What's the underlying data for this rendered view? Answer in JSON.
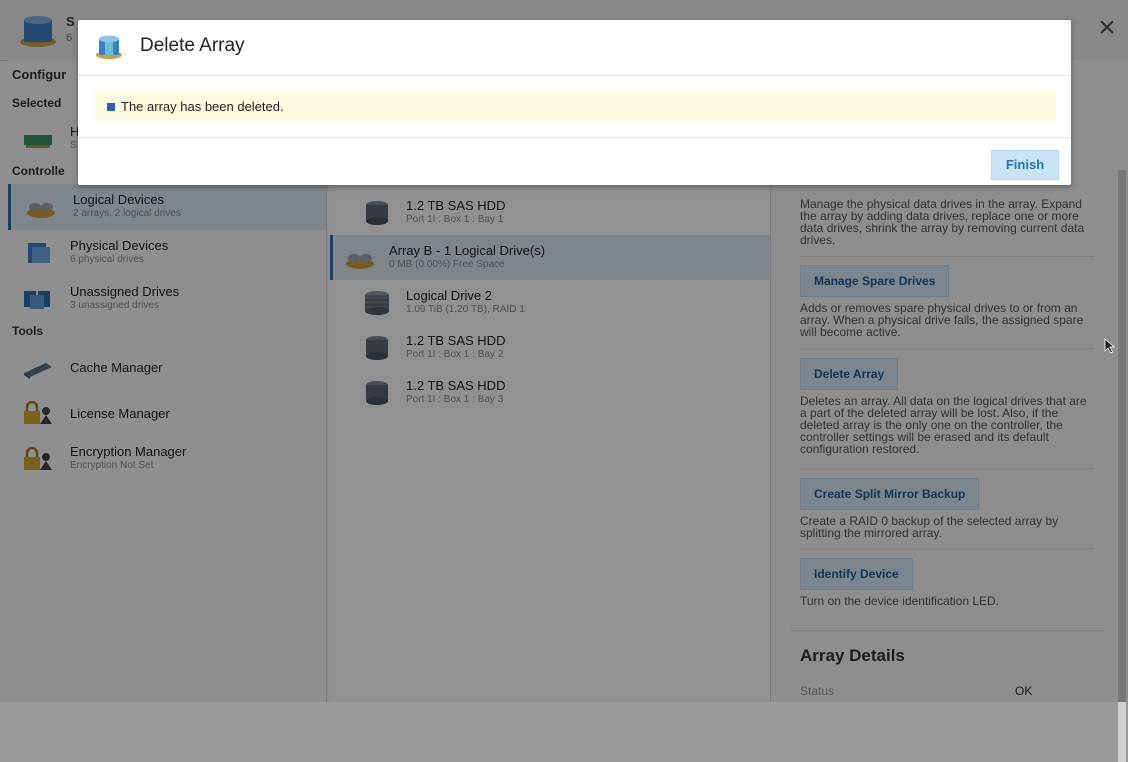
{
  "header": {
    "controller_title": "S",
    "controller_sub": "6"
  },
  "left": {
    "configure_label": "Configur",
    "selected_label": "Selected",
    "selected_device": {
      "t1": "H",
      "t2": "S"
    },
    "controller_label": "Controlle",
    "items": [
      {
        "label": "Logical Devices",
        "sub": "2 arrays, 2 logical drives"
      },
      {
        "label": "Physical Devices",
        "sub": "6 physical drives"
      },
      {
        "label": "Unassigned Drives",
        "sub": "3 unassigned drives"
      }
    ],
    "tools_label": "Tools",
    "tools": [
      {
        "label": "Cache Manager",
        "sub": ""
      },
      {
        "label": "License Manager",
        "sub": ""
      },
      {
        "label": "Encryption Manager",
        "sub": "Encryption Not Set"
      }
    ]
  },
  "middle": {
    "rows": [
      {
        "t1": "1.2 TB SAS HDD",
        "t2": "Port 1I : Box 1 : Bay 1"
      },
      {
        "t1": "Array B - 1 Logical Drive(s)",
        "t2": "0 MB (0.00%) Free Space"
      },
      {
        "t1": "Logical Drive 2",
        "t2": "1.09 TiB (1.20 TB), RAID 1"
      },
      {
        "t1": "1.2 TB SAS HDD",
        "t2": "Port 1I : Box 1 : Bay 2"
      },
      {
        "t1": "1.2 TB SAS HDD",
        "t2": "Port 1I : Box 1 : Bay 3"
      }
    ]
  },
  "right": {
    "desc_modify": "Manage the physical data drives in the array. Expand the array by adding data drives, replace one or more data drives, shrink the array by removing current data drives.",
    "btn_spare": "Manage Spare Drives",
    "desc_spare": "Adds or removes spare physical drives to or from an array. When a physical drive fails, the assigned spare will become active.",
    "btn_delete": "Delete Array",
    "desc_delete": "Deletes an array. All data on the logical drives that are a part of the deleted array will be lost. Also, if the deleted array is the only one on the controller, the controller settings will be erased and its default configuration restored.",
    "btn_split": "Create Split Mirror Backup",
    "desc_split": "Create a RAID 0 backup of the selected array by splitting the mirrored array.",
    "btn_identify": "Identify Device",
    "desc_identify": "Turn on the device identification LED.",
    "details_title": "Array Details",
    "status_label": "Status",
    "status_value": "OK"
  },
  "dialog": {
    "title": "Delete Array",
    "message": "The array has been deleted.",
    "finish_label": "Finish"
  },
  "colors": {
    "accent": "#2e6fa8",
    "message_bg": "#fdfbe0",
    "button_bg": "#c9e4f6"
  }
}
